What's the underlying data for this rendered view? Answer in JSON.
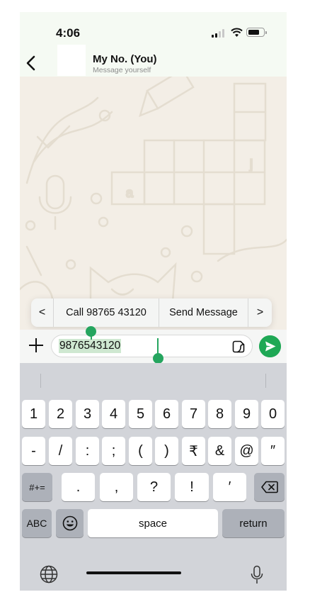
{
  "status_bar": {
    "time": "4:06"
  },
  "header": {
    "back_icon": "chevron-left-icon",
    "name": "My No. (You)",
    "subtitle": "Message yourself"
  },
  "context_menu": {
    "prev_label": "<",
    "call_label": "Call 98765 43120",
    "send_label": "Send Message",
    "next_label": ">"
  },
  "input": {
    "value": "9876543120",
    "plus_icon": "plus-icon",
    "sticker_icon": "sticker-icon",
    "send_icon": "send-icon"
  },
  "keyboard": {
    "row1": [
      "1",
      "2",
      "3",
      "4",
      "5",
      "6",
      "7",
      "8",
      "9",
      "0"
    ],
    "row2": [
      "-",
      "/",
      ":",
      ";",
      "(",
      ")",
      "₹",
      "&",
      "@",
      "″"
    ],
    "row3_mode": "#+=",
    "row3": [
      ".",
      ",",
      "?",
      "!",
      "′"
    ],
    "abc_label": "ABC",
    "space_label": "space",
    "return_label": "return"
  },
  "colors": {
    "accent": "#25a55f",
    "header_bg": "#f5faf3",
    "keyboard_bg": "#d2d4d9"
  }
}
